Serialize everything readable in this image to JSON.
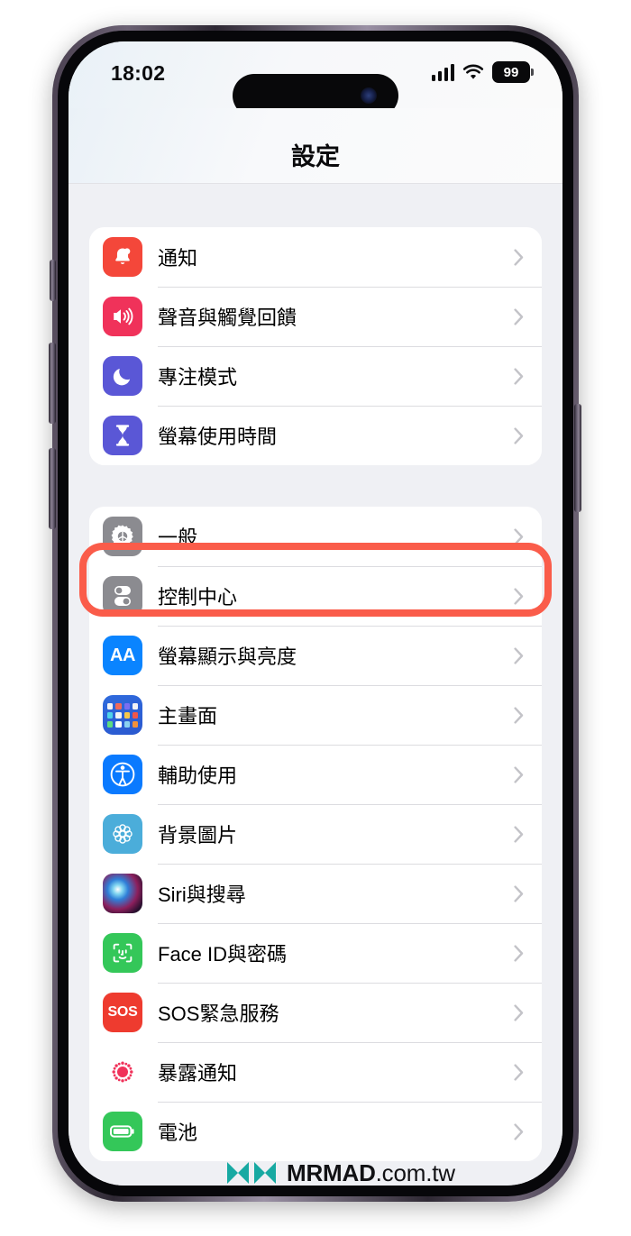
{
  "status_bar": {
    "time": "18:02",
    "battery_level": "99",
    "signal_icon": "cellular-signal-icon",
    "wifi_icon": "wifi-icon",
    "battery_icon": "battery-icon"
  },
  "nav": {
    "title": "設定"
  },
  "groups": [
    {
      "rows": [
        {
          "label": "通知",
          "icon": "bell-icon",
          "icon_class": "ic-notif",
          "color": "#f4473a"
        },
        {
          "label": "聲音與觸覺回饋",
          "icon": "speaker-icon",
          "icon_class": "ic-sound",
          "color": "#f0325a"
        },
        {
          "label": "專注模式",
          "icon": "moon-icon",
          "icon_class": "ic-focus",
          "color": "#5a57d6"
        },
        {
          "label": "螢幕使用時間",
          "icon": "hourglass-icon",
          "icon_class": "ic-screen",
          "color": "#5a57d6"
        }
      ]
    },
    {
      "rows": [
        {
          "label": "一般",
          "icon": "gear-icon",
          "icon_class": "ic-general",
          "color": "#8b8b90",
          "highlighted": true
        },
        {
          "label": "控制中心",
          "icon": "toggles-icon",
          "icon_class": "ic-control",
          "color": "#8b8b90"
        },
        {
          "label": "螢幕顯示與亮度",
          "icon": "aa-text-icon",
          "icon_class": "ic-display",
          "color": "#0a84ff"
        },
        {
          "label": "主畫面",
          "icon": "home-screen-grid-icon",
          "icon_class": "ic-home",
          "color": "#2f6bdd"
        },
        {
          "label": "輔助使用",
          "icon": "accessibility-icon",
          "icon_class": "ic-access",
          "color": "#0a7aff"
        },
        {
          "label": "背景圖片",
          "icon": "wallpaper-flower-icon",
          "icon_class": "ic-wall",
          "color": "#4badda"
        },
        {
          "label": "Siri與搜尋",
          "icon": "siri-orb-icon",
          "icon_class": "ic-siri",
          "color": "#2f7fd8"
        },
        {
          "label": "Face ID與密碼",
          "icon": "face-id-icon",
          "icon_class": "ic-faceid",
          "color": "#34c759"
        },
        {
          "label": "SOS緊急服務",
          "icon": "sos-icon",
          "icon_class": "ic-sos",
          "color": "#ee3b2f"
        },
        {
          "label": "暴露通知",
          "icon": "exposure-dots-icon",
          "icon_class": "ic-expo",
          "color": "#f0325a"
        },
        {
          "label": "電池",
          "icon": "battery-app-icon",
          "icon_class": "ic-batt",
          "color": "#34c759"
        }
      ]
    }
  ],
  "annotation": {
    "highlight_target": "一般",
    "highlight_color": "#fa5c4a"
  },
  "watermark": {
    "brand": "MRMAD",
    "domain": ".com.tw",
    "logo_color": "#17a9a2",
    "logo_icon": "mrmad-infinity-logo-icon"
  },
  "device": {
    "home_indicator": "home-indicator",
    "buttons": [
      "mute-switch",
      "volume-up-button",
      "volume-down-button",
      "power-button"
    ]
  }
}
